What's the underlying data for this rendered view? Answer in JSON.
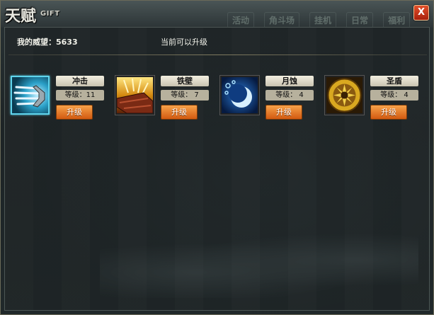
{
  "window": {
    "title_cn": "天赋",
    "title_en": "GIFT",
    "close_label": "X",
    "background_tabs": [
      "活动",
      "角斗场",
      "挂机",
      "日常",
      "福利"
    ]
  },
  "status": {
    "prestige_label": "我的威望：",
    "prestige_value": "5633",
    "hint": "当前可以升级"
  },
  "skills": [
    {
      "name": "冲击",
      "level_text": "等级：11",
      "level": 11,
      "button": "升级",
      "icon": "charge-icon",
      "selected": true
    },
    {
      "name": "铁壁",
      "level_text": "等级： 7",
      "level": 7,
      "button": "升级",
      "icon": "iron-wall-icon",
      "selected": false
    },
    {
      "name": "月蚀",
      "level_text": "等级： 4",
      "level": 4,
      "button": "升级",
      "icon": "lunar-eclipse-icon",
      "selected": false
    },
    {
      "name": "圣盾",
      "level_text": "等级： 4",
      "level": 4,
      "button": "升级",
      "icon": "holy-shield-icon",
      "selected": false
    }
  ],
  "colors": {
    "accent_button": "#e8781c",
    "selection_border": "#5fd4ec",
    "close_button": "#c8361a"
  }
}
